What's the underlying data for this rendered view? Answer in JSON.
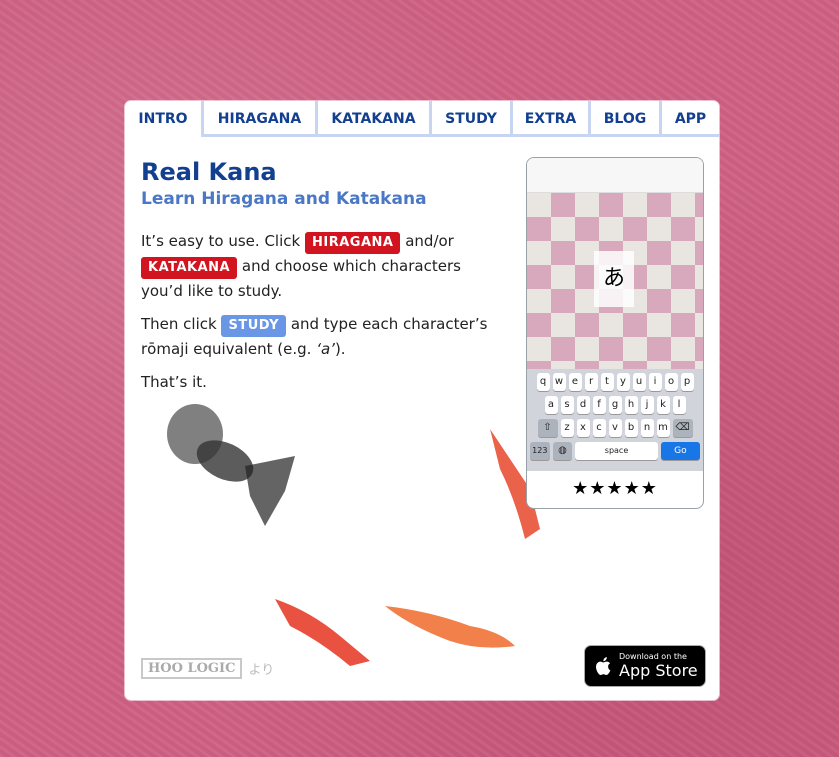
{
  "tabs": [
    "INTRO",
    "HIRAGANA",
    "KATAKANA",
    "STUDY",
    "EXTRA",
    "BLOG",
    "APP"
  ],
  "title": "Real Kana",
  "subtitle": "Learn Hiragana and Katakana",
  "intro": {
    "p1_a": "It’s easy to use. Click",
    "hiragana_pill": "HIRAGANA",
    "p1_b": "and/or",
    "katakana_pill": "KATAKANA",
    "p1_c": "and choose which characters you’d like to study.",
    "p2_a": "Then click",
    "study_pill": "STUDY",
    "p2_b": "and type each character’s rōmaji equivalent (e.g.",
    "p2_example": "‘a’",
    "p2_c": ").",
    "p3": "That’s it."
  },
  "phone": {
    "glyph": "あ",
    "keys_row1": [
      "q",
      "w",
      "e",
      "r",
      "t",
      "y",
      "u",
      "i",
      "o",
      "p"
    ],
    "keys_row2": [
      "a",
      "s",
      "d",
      "f",
      "g",
      "h",
      "j",
      "k",
      "l"
    ],
    "keys_row3": [
      "z",
      "x",
      "c",
      "v",
      "b",
      "n",
      "m"
    ],
    "num_key": "123",
    "space_key": "space",
    "go_key": "Go",
    "rating_stars": 4.5,
    "stars_text": "★★★★★"
  },
  "footer": {
    "hoo_logic": "HOO LOGIC",
    "yori": "より",
    "appstore_small": "Download on the",
    "appstore_big": "App Store"
  },
  "colors": {
    "background": "#cf6184",
    "accent_blue": "#123f8f",
    "pill_red": "#d1141f",
    "pill_blue": "#6a96e6"
  }
}
